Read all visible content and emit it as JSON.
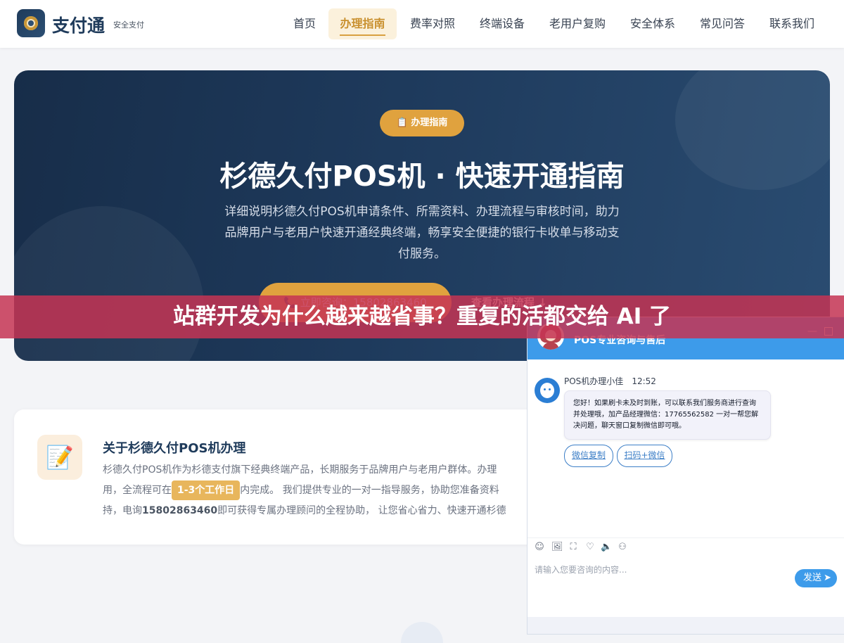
{
  "header": {
    "logo_text": "支付通",
    "logo_sub": "安全支付",
    "nav": [
      {
        "label": "首页"
      },
      {
        "label": "办理指南"
      },
      {
        "label": "费率对照"
      },
      {
        "label": "终端设备"
      },
      {
        "label": "老用户复购"
      },
      {
        "label": "安全体系"
      },
      {
        "label": "常见问答"
      },
      {
        "label": "联系我们"
      }
    ],
    "active_index": 1
  },
  "hero": {
    "badge": "📋 办理指南",
    "title": "杉德久付POS机 · 快速开通指南",
    "desc_lines": [
      "详细说明杉德久付POS机申请条件、所需资料、办理流程与审核时间，助力",
      "品牌用户与老用户快速开通经典终端，畅享安全便捷的银行卡收单与移动支",
      "付服务。"
    ],
    "consult_button": "📞 立即咨询：15802863460",
    "flow_link": "查看办理流程 ↓"
  },
  "banner": {
    "text": "站群开发为什么越来越省事？重复的活都交给 AI 了"
  },
  "about": {
    "icon": "📝",
    "title": "关于杉德久付POS机办理",
    "line1": "杉德久付POS机作为杉德支付旗下经典终端产品，长期服务于品牌用户与老用户群体。办理",
    "line2_a": "用，全流程可在",
    "line2_highlight": "1-3个工作日",
    "line2_b": "内完成。 我们提供专业的一对一指导服务，协助您准备资料",
    "line3_a": "持，电询",
    "line3_phone": "15802863460",
    "line3_b": "即可获得专属办理顾问的全程协助， 让您省心省力、快速开通杉德"
  },
  "chat": {
    "title": "POS专业咨询与售后",
    "agent_name": "POS机办理小佳",
    "time": "12:52",
    "message": "您好！如果刷卡未及时到账，可以联系我们服务商进行查询并处理哦，加产品经理微信：17765562582 一对一帮您解决问题，聊天窗口复制微信即可哦。",
    "copy_wechat": "微信复制",
    "scan_wechat": "扫码+微信",
    "input_placeholder": "请输入您要咨询的内容...",
    "send_label": "发送",
    "tools": [
      "☺",
      "🖼",
      "⛶",
      "♡",
      "🔈",
      "⚇"
    ]
  },
  "colors": {
    "brand_navy": "#1f3b5b",
    "accent_gold": "#e0a23e",
    "chat_blue": "#3d9bea",
    "banner_red": "#c43454"
  }
}
